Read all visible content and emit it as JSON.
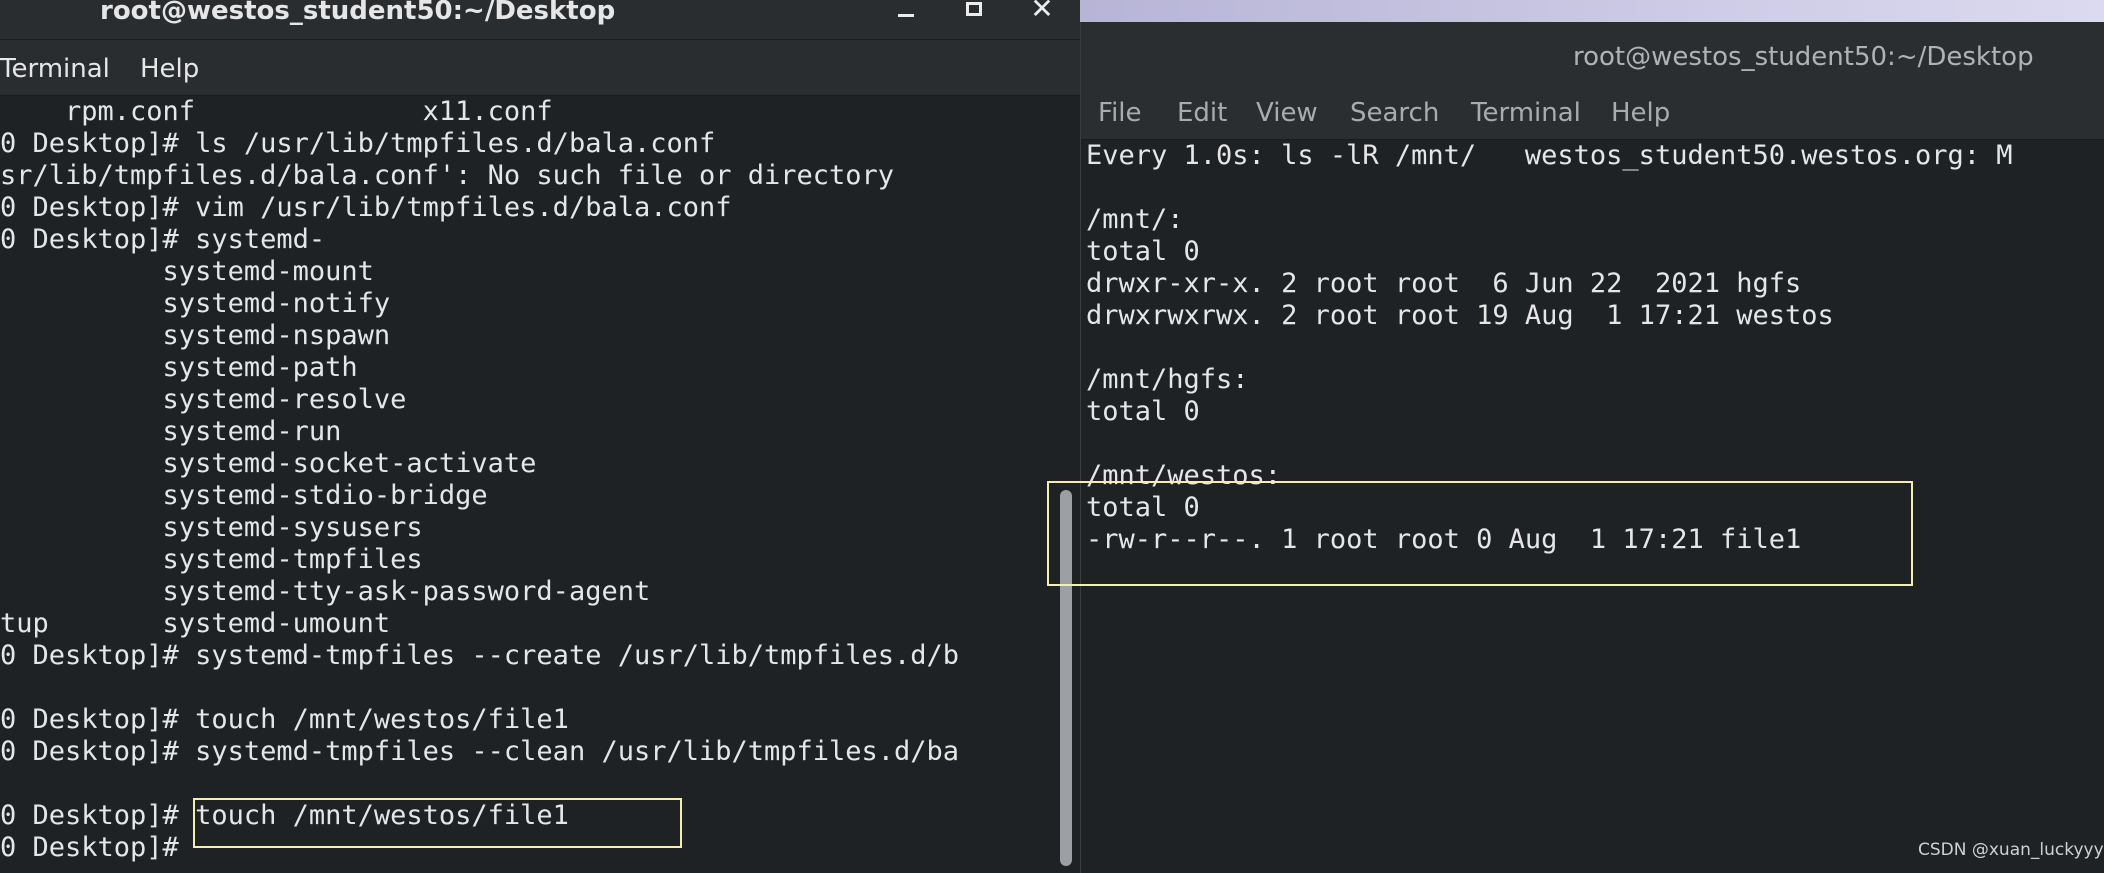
{
  "left_window": {
    "title": "root@westos_student50:~/Desktop",
    "controls": {
      "minimize": "minimize",
      "maximize": "maximize",
      "close": "✕"
    },
    "menu": [
      "Terminal",
      "Help"
    ],
    "lines": [
      "    rpm.conf              x11.conf",
      "0 Desktop]# ls /usr/lib/tmpfiles.d/bala.conf",
      "sr/lib/tmpfiles.d/bala.conf': No such file or directory",
      "0 Desktop]# vim /usr/lib/tmpfiles.d/bala.conf",
      "0 Desktop]# systemd-",
      "          systemd-mount",
      "          systemd-notify",
      "          systemd-nspawn",
      "          systemd-path",
      "          systemd-resolve",
      "          systemd-run",
      "          systemd-socket-activate",
      "          systemd-stdio-bridge",
      "          systemd-sysusers",
      "          systemd-tmpfiles",
      "          systemd-tty-ask-password-agent",
      "tup       systemd-umount",
      "0 Desktop]# systemd-tmpfiles --create /usr/lib/tmpfiles.d/b",
      "",
      "0 Desktop]# touch /mnt/westos/file1",
      "0 Desktop]# systemd-tmpfiles --clean /usr/lib/tmpfiles.d/ba",
      "",
      "0 Desktop]# touch /mnt/westos/file1",
      "0 Desktop]#"
    ]
  },
  "right_window": {
    "title": "root@westos_student50:~/Desktop",
    "menu": [
      "File",
      "Edit",
      "View",
      "Search",
      "Terminal",
      "Help"
    ],
    "lines": [
      "Every 1.0s: ls -lR /mnt/   westos_student50.westos.org: M",
      "",
      "/mnt/:",
      "total 0",
      "drwxr-xr-x. 2 root root  6 Jun 22  2021 hgfs",
      "drwxrwxrwx. 2 root root 19 Aug  1 17:21 westos",
      "",
      "/mnt/hgfs:",
      "total 0",
      "",
      "/mnt/westos:",
      "total 0",
      "-rw-r--r--. 1 root root 0 Aug  1 17:21 file1"
    ]
  },
  "watermark": "CSDN @xuan_luckyyy",
  "colors": {
    "terminal_bg": "#1f2225",
    "terminal_fg": "#e6e6e6",
    "highlight": "#f5eeb0"
  }
}
